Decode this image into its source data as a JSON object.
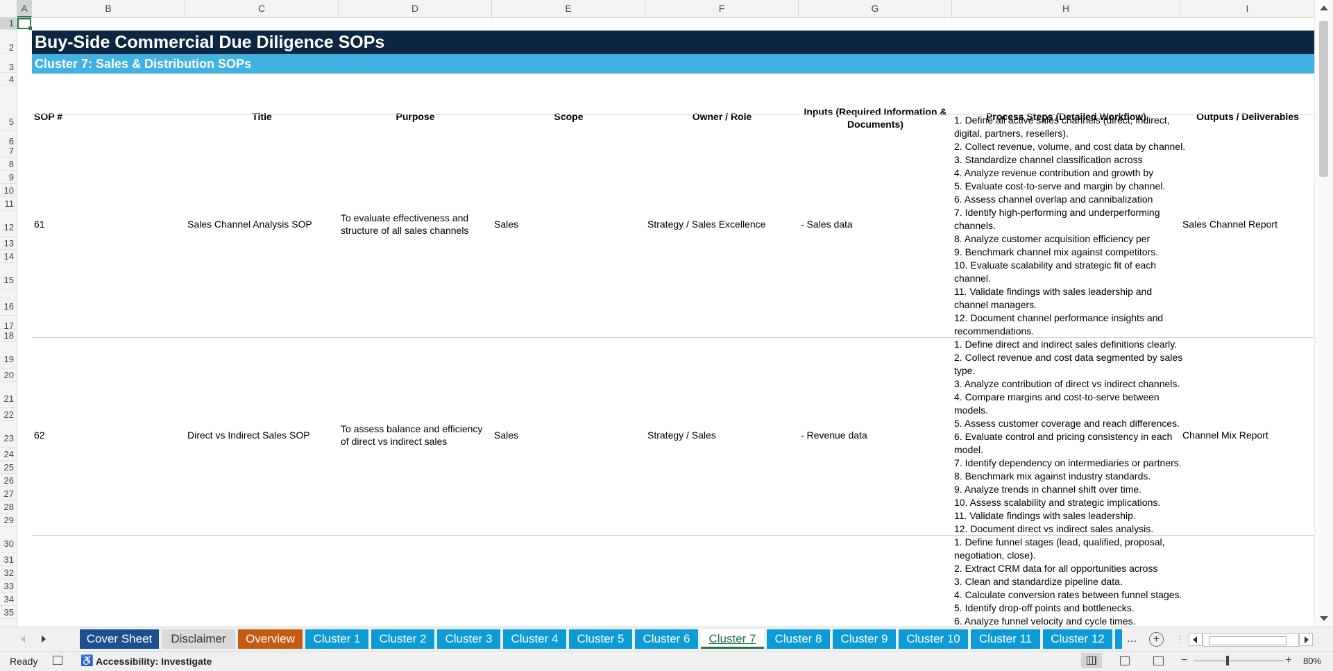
{
  "columns": [
    "A",
    "B",
    "C",
    "D",
    "E",
    "F",
    "G",
    "H",
    "I"
  ],
  "rows": [
    "1",
    "2",
    "3",
    "4",
    "5",
    "6",
    "7",
    "8",
    "9",
    "10",
    "11",
    "12",
    "13",
    "14",
    "15",
    "16",
    "17",
    "18",
    "19",
    "20",
    "21",
    "22",
    "23",
    "24",
    "25",
    "26",
    "27",
    "28",
    "29",
    "30",
    "31",
    "32",
    "33",
    "34",
    "35"
  ],
  "title": "Buy-Side Commercial Due Diligence SOPs",
  "subtitle": "Cluster 7: Sales & Distribution SOPs",
  "headers": {
    "sop": "SOP #",
    "title": "Title",
    "purpose": "Purpose",
    "scope": "Scope",
    "owner": "Owner / Role",
    "inputs_line1": "Inputs (Required Information &",
    "inputs_line2": "Documents)",
    "process": "Process Steps (Detailed Workflow)",
    "outputs": "Outputs / Deliverables"
  },
  "records": [
    {
      "sop": "61",
      "title": "Sales Channel Analysis SOP",
      "purpose_line1": "To evaluate effectiveness and",
      "purpose_line2": "structure of all sales channels",
      "scope": "Sales",
      "owner": "Strategy / Sales Excellence",
      "inputs": "- Sales data",
      "steps": [
        "1. Define all active sales channels (direct, indirect,",
        "digital, partners, resellers).",
        "2. Collect revenue, volume, and cost data by channel.",
        "3. Standardize channel classification across",
        "4. Analyze revenue contribution and growth by",
        "5. Evaluate cost-to-serve and margin by channel.",
        "6. Assess channel overlap and cannibalization",
        "7. Identify high-performing and underperforming",
        "channels.",
        "8. Analyze customer acquisition efficiency per",
        "9. Benchmark channel mix against competitors.",
        "10. Evaluate scalability and strategic fit of each",
        "channel.",
        "11. Validate findings with sales leadership and",
        "channel managers.",
        "12. Document channel performance insights and",
        "recommendations."
      ],
      "outputs": "Sales Channel Report"
    },
    {
      "sop": "62",
      "title": "Direct vs Indirect Sales SOP",
      "purpose_line1": "To assess balance and efficiency",
      "purpose_line2": "of direct vs indirect sales",
      "scope": "Sales",
      "owner": "Strategy / Sales",
      "inputs": "- Revenue data",
      "steps": [
        "1. Define direct and indirect sales definitions clearly.",
        "2. Collect revenue and cost data segmented by sales",
        "type.",
        "3. Analyze contribution of direct vs indirect channels.",
        "4. Compare margins and cost-to-serve between",
        "models.",
        "5. Assess customer coverage and reach differences.",
        "6. Evaluate control and pricing consistency in each",
        "model.",
        "7. Identify dependency on intermediaries or partners.",
        "8. Benchmark mix against industry standards.",
        "9. Analyze trends in channel shift over time.",
        "10. Assess scalability and strategic implications.",
        "11. Validate findings with sales leadership.",
        "12. Document direct vs indirect sales analysis."
      ],
      "outputs": "Channel Mix Report"
    },
    {
      "steps": [
        "1. Define funnel stages (lead, qualified, proposal,",
        "negotiation, close).",
        "2. Extract CRM data for all opportunities across",
        "3. Clean and standardize pipeline data.",
        "4. Calculate conversion rates between funnel stages.",
        "5. Identify drop-off points and bottlenecks.",
        "6. Analyze funnel velocity and cycle times."
      ]
    }
  ],
  "tabs": [
    {
      "label": "Cover Sheet",
      "color": "#1d4f91",
      "text": "#ffffff"
    },
    {
      "label": "Disclaimer",
      "color": "#d9d9d9",
      "text": "#333333"
    },
    {
      "label": "Overview",
      "color": "#c55a11",
      "text": "#ffffff"
    },
    {
      "label": "Cluster 1",
      "color": "#0d9bd8",
      "text": "#ffffff"
    },
    {
      "label": "Cluster 2",
      "color": "#0d9bd8",
      "text": "#ffffff"
    },
    {
      "label": "Cluster 3",
      "color": "#0d9bd8",
      "text": "#ffffff"
    },
    {
      "label": "Cluster 4",
      "color": "#0d9bd8",
      "text": "#ffffff"
    },
    {
      "label": "Cluster 5",
      "color": "#0d9bd8",
      "text": "#ffffff"
    },
    {
      "label": "Cluster 6",
      "color": "#0d9bd8",
      "text": "#ffffff"
    },
    {
      "label": "Cluster 7",
      "color": "#ffffff",
      "text": "#217346",
      "active": true
    },
    {
      "label": "Cluster 8",
      "color": "#0d9bd8",
      "text": "#ffffff"
    },
    {
      "label": "Cluster 9",
      "color": "#0d9bd8",
      "text": "#ffffff"
    },
    {
      "label": "Cluster 10",
      "color": "#0d9bd8",
      "text": "#ffffff"
    },
    {
      "label": "Cluster 11",
      "color": "#0d9bd8",
      "text": "#ffffff"
    },
    {
      "label": "Cluster 12",
      "color": "#0d9bd8",
      "text": "#ffffff"
    }
  ],
  "tab_more": "...",
  "status": {
    "ready": "Ready",
    "accessibility": "Accessibility: Investigate",
    "zoom": "80%"
  },
  "colors": {
    "title_bg": "#0c2742",
    "subtitle_bg": "#40b1e0",
    "excel_green": "#217346"
  }
}
